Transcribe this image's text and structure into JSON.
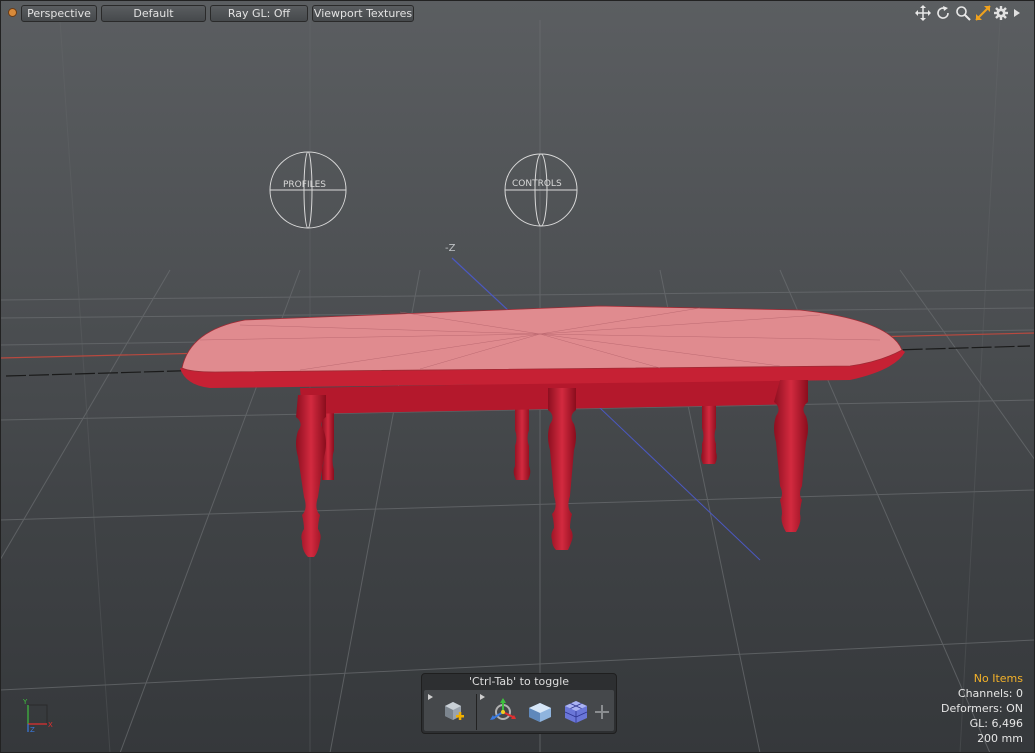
{
  "toolbar": {
    "view_mode": "Perspective",
    "shading": "Default",
    "ray_gl": "Ray GL: Off",
    "viewport_textures": "Viewport Textures"
  },
  "viewport": {
    "axis_label": "-Z",
    "locator_profiles": "PROFILES",
    "locator_controls": "CONTROLS"
  },
  "palette": {
    "title": "'Ctrl-Tab' to toggle"
  },
  "status": {
    "items": "No Items",
    "channels": "Channels: 0",
    "deformers": "Deformers: ON",
    "gl": "GL: 6,496",
    "grid": "200 mm"
  },
  "gizmo": {
    "y": "Y",
    "z": "Z",
    "x": "X"
  },
  "colors": {
    "table_top": "#e08b8f",
    "table_body": "#c01c30",
    "accent_orange": "#d88a3a",
    "status_warn": "#f3b229"
  },
  "icons": [
    "move-view-icon",
    "rotate-view-icon",
    "zoom-view-icon",
    "maximize-icon",
    "gear-icon",
    "menu-arrow-icon",
    "add-item-icon",
    "transform-tool-icon",
    "cube-primitive-icon",
    "grid-cubes-icon",
    "add-icon"
  ]
}
